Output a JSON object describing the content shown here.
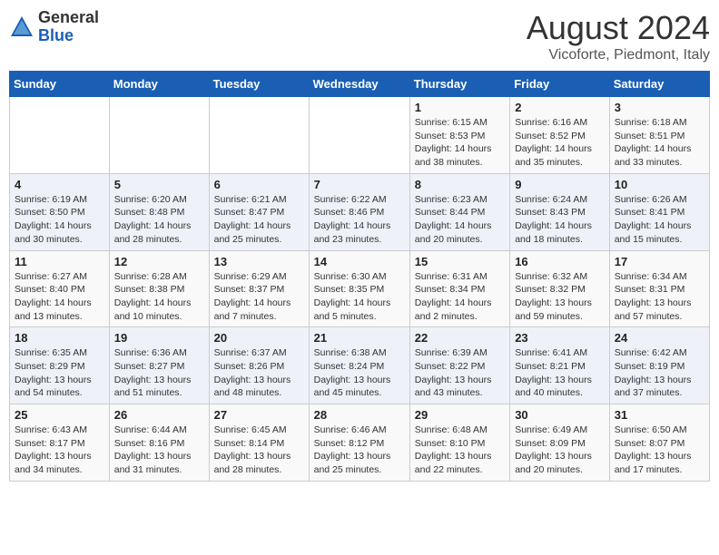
{
  "logo": {
    "general": "General",
    "blue": "Blue"
  },
  "header": {
    "month_year": "August 2024",
    "location": "Vicoforte, Piedmont, Italy"
  },
  "days_of_week": [
    "Sunday",
    "Monday",
    "Tuesday",
    "Wednesday",
    "Thursday",
    "Friday",
    "Saturday"
  ],
  "weeks": [
    [
      {
        "day": "",
        "info": ""
      },
      {
        "day": "",
        "info": ""
      },
      {
        "day": "",
        "info": ""
      },
      {
        "day": "",
        "info": ""
      },
      {
        "day": "1",
        "info": "Sunrise: 6:15 AM\nSunset: 8:53 PM\nDaylight: 14 hours\nand 38 minutes."
      },
      {
        "day": "2",
        "info": "Sunrise: 6:16 AM\nSunset: 8:52 PM\nDaylight: 14 hours\nand 35 minutes."
      },
      {
        "day": "3",
        "info": "Sunrise: 6:18 AM\nSunset: 8:51 PM\nDaylight: 14 hours\nand 33 minutes."
      }
    ],
    [
      {
        "day": "4",
        "info": "Sunrise: 6:19 AM\nSunset: 8:50 PM\nDaylight: 14 hours\nand 30 minutes."
      },
      {
        "day": "5",
        "info": "Sunrise: 6:20 AM\nSunset: 8:48 PM\nDaylight: 14 hours\nand 28 minutes."
      },
      {
        "day": "6",
        "info": "Sunrise: 6:21 AM\nSunset: 8:47 PM\nDaylight: 14 hours\nand 25 minutes."
      },
      {
        "day": "7",
        "info": "Sunrise: 6:22 AM\nSunset: 8:46 PM\nDaylight: 14 hours\nand 23 minutes."
      },
      {
        "day": "8",
        "info": "Sunrise: 6:23 AM\nSunset: 8:44 PM\nDaylight: 14 hours\nand 20 minutes."
      },
      {
        "day": "9",
        "info": "Sunrise: 6:24 AM\nSunset: 8:43 PM\nDaylight: 14 hours\nand 18 minutes."
      },
      {
        "day": "10",
        "info": "Sunrise: 6:26 AM\nSunset: 8:41 PM\nDaylight: 14 hours\nand 15 minutes."
      }
    ],
    [
      {
        "day": "11",
        "info": "Sunrise: 6:27 AM\nSunset: 8:40 PM\nDaylight: 14 hours\nand 13 minutes."
      },
      {
        "day": "12",
        "info": "Sunrise: 6:28 AM\nSunset: 8:38 PM\nDaylight: 14 hours\nand 10 minutes."
      },
      {
        "day": "13",
        "info": "Sunrise: 6:29 AM\nSunset: 8:37 PM\nDaylight: 14 hours\nand 7 minutes."
      },
      {
        "day": "14",
        "info": "Sunrise: 6:30 AM\nSunset: 8:35 PM\nDaylight: 14 hours\nand 5 minutes."
      },
      {
        "day": "15",
        "info": "Sunrise: 6:31 AM\nSunset: 8:34 PM\nDaylight: 14 hours\nand 2 minutes."
      },
      {
        "day": "16",
        "info": "Sunrise: 6:32 AM\nSunset: 8:32 PM\nDaylight: 13 hours\nand 59 minutes."
      },
      {
        "day": "17",
        "info": "Sunrise: 6:34 AM\nSunset: 8:31 PM\nDaylight: 13 hours\nand 57 minutes."
      }
    ],
    [
      {
        "day": "18",
        "info": "Sunrise: 6:35 AM\nSunset: 8:29 PM\nDaylight: 13 hours\nand 54 minutes."
      },
      {
        "day": "19",
        "info": "Sunrise: 6:36 AM\nSunset: 8:27 PM\nDaylight: 13 hours\nand 51 minutes."
      },
      {
        "day": "20",
        "info": "Sunrise: 6:37 AM\nSunset: 8:26 PM\nDaylight: 13 hours\nand 48 minutes."
      },
      {
        "day": "21",
        "info": "Sunrise: 6:38 AM\nSunset: 8:24 PM\nDaylight: 13 hours\nand 45 minutes."
      },
      {
        "day": "22",
        "info": "Sunrise: 6:39 AM\nSunset: 8:22 PM\nDaylight: 13 hours\nand 43 minutes."
      },
      {
        "day": "23",
        "info": "Sunrise: 6:41 AM\nSunset: 8:21 PM\nDaylight: 13 hours\nand 40 minutes."
      },
      {
        "day": "24",
        "info": "Sunrise: 6:42 AM\nSunset: 8:19 PM\nDaylight: 13 hours\nand 37 minutes."
      }
    ],
    [
      {
        "day": "25",
        "info": "Sunrise: 6:43 AM\nSunset: 8:17 PM\nDaylight: 13 hours\nand 34 minutes."
      },
      {
        "day": "26",
        "info": "Sunrise: 6:44 AM\nSunset: 8:16 PM\nDaylight: 13 hours\nand 31 minutes."
      },
      {
        "day": "27",
        "info": "Sunrise: 6:45 AM\nSunset: 8:14 PM\nDaylight: 13 hours\nand 28 minutes."
      },
      {
        "day": "28",
        "info": "Sunrise: 6:46 AM\nSunset: 8:12 PM\nDaylight: 13 hours\nand 25 minutes."
      },
      {
        "day": "29",
        "info": "Sunrise: 6:48 AM\nSunset: 8:10 PM\nDaylight: 13 hours\nand 22 minutes."
      },
      {
        "day": "30",
        "info": "Sunrise: 6:49 AM\nSunset: 8:09 PM\nDaylight: 13 hours\nand 20 minutes."
      },
      {
        "day": "31",
        "info": "Sunrise: 6:50 AM\nSunset: 8:07 PM\nDaylight: 13 hours\nand 17 minutes."
      }
    ]
  ]
}
